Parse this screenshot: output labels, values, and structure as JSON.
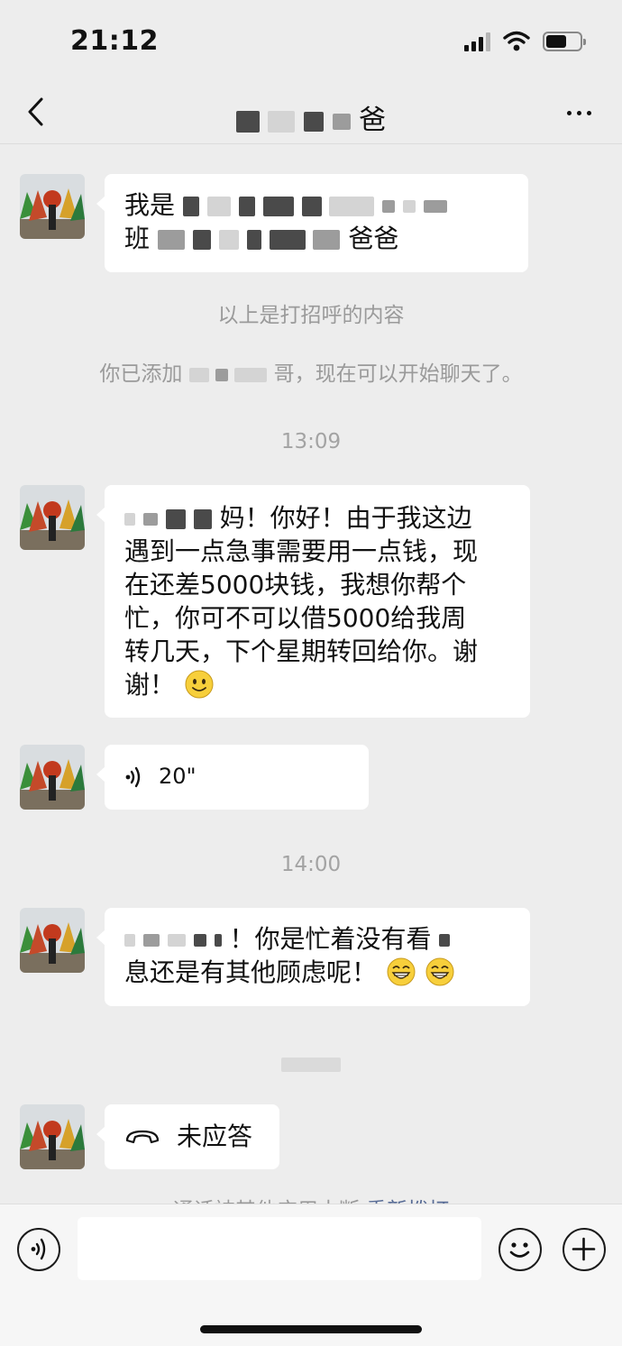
{
  "status_bar": {
    "time": "21:12"
  },
  "nav": {
    "title": "爸"
  },
  "messages": {
    "m1": {
      "line1": "我是",
      "line2_prefix": "班",
      "line2_suffix": "爸爸"
    },
    "system1": "以上是打招呼的内容",
    "system2_prefix": "你已添加",
    "system2_suffix": "哥，现在可以开始聊天了。",
    "time1": "13:09",
    "m2": {
      "start": "妈！你好！由于我这边",
      "lines": [
        "遇到一点急事需要用一点钱，现",
        "在还差5000块钱，我想你帮个",
        "忙，你可不可以借5000给我周",
        "转几天，下个星期转回给你。谢"
      ],
      "end": "谢！"
    },
    "voice": {
      "duration": "20\""
    },
    "time2": "14:00",
    "m3": {
      "line1": "！你是忙着没有看",
      "line2": "息还是有其他顾虑呢！"
    },
    "call": {
      "label": "未应答"
    },
    "system3": {
      "text": "通话被其他应用中断",
      "link": "重新拨打"
    }
  },
  "input_bar": {
    "placeholder": ""
  },
  "colors": {
    "background": "#ededed",
    "bubble": "#ffffff",
    "system_text": "#9a9a9a",
    "link": "#576b95"
  },
  "icons": [
    "back-arrow-icon",
    "more-dots-icon",
    "voice-icon",
    "emoji-icon",
    "plus-icon",
    "phone-hangup-icon",
    "smile-emoji-icon",
    "grin-emoji-icon"
  ]
}
